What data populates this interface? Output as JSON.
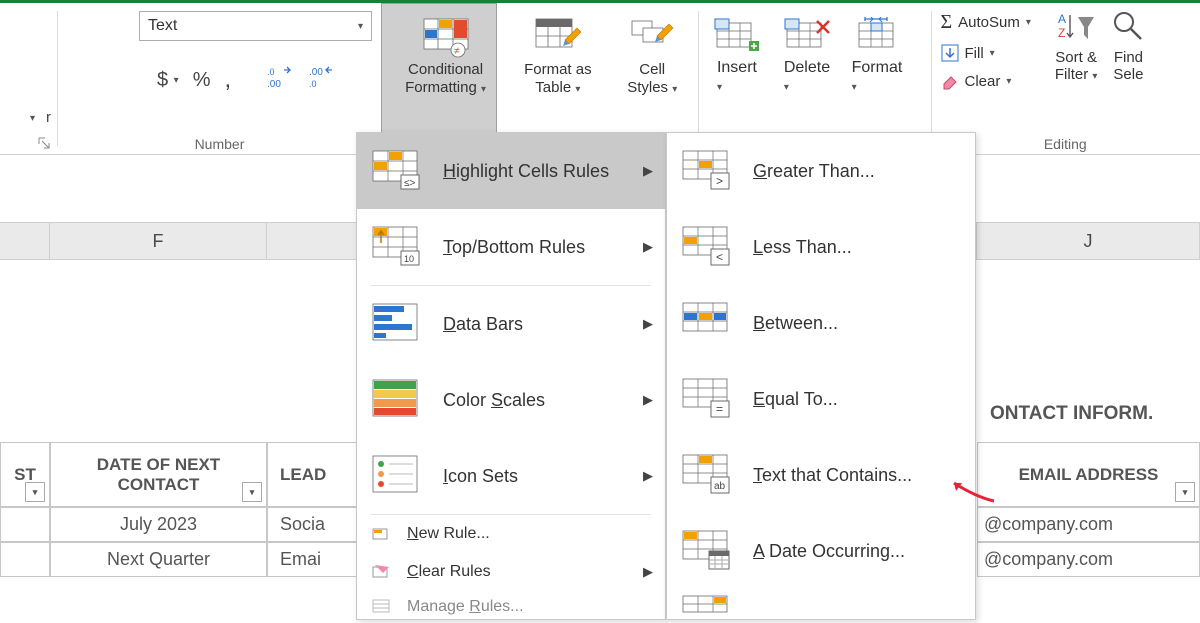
{
  "ribbon": {
    "number": {
      "format_label": "Text",
      "currency_glyph": "$",
      "percent_glyph": "%",
      "comma_glyph": ",",
      "inc_dec_label": ".00",
      "group_label": "Number"
    },
    "styles": {
      "conditional_line1": "Conditional",
      "conditional_line2": "Formatting",
      "format_as_line1": "Format as",
      "format_as_line2": "Table",
      "cell_line1": "Cell",
      "cell_line2": "Styles"
    },
    "cells": {
      "insert": "Insert",
      "delete": "Delete",
      "format": "Format"
    },
    "editing": {
      "autosum": "AutoSum",
      "fill": "Fill",
      "clear": "Clear",
      "sort_filter_line1": "Sort &",
      "sort_filter_line2": "Filter",
      "find_select_line1": "Find",
      "find_select_line2": "Sele",
      "group_label": "Editing"
    }
  },
  "menu1": {
    "highlight": "ighlight Cells Rules",
    "topbottom": "op/Bottom Rules",
    "databars": "ata Bars",
    "colorscales": "Color ",
    "colorscales_tail": "cales",
    "iconsets": "con Sets",
    "newrule": "ew Rule...",
    "clearrules": "lear Rules",
    "managerules": "Manage ",
    "managerules_tail": "ules..."
  },
  "menu2": {
    "greater": "reater Than...",
    "less": "ess Than...",
    "between": "etween...",
    "equal": "qual To...",
    "textcontains": "ext that Contains...",
    "dateoccurring": " Date Occurring..."
  },
  "sheet": {
    "col_F": "F",
    "col_J": "J",
    "hdr_st": "ST",
    "hdr_date_next_contact": "DATE OF NEXT CONTACT",
    "hdr_lead": "LEAD",
    "hdr_email": "EMAIL ADDRESS",
    "contact_info": "ONTACT INFORM.",
    "row1_date": "July 2023",
    "row1_lead": "Socia",
    "row1_email": "@company.com",
    "row2_date": "Next Quarter",
    "row2_lead": "Emai",
    "row2_email": "@company.com"
  }
}
